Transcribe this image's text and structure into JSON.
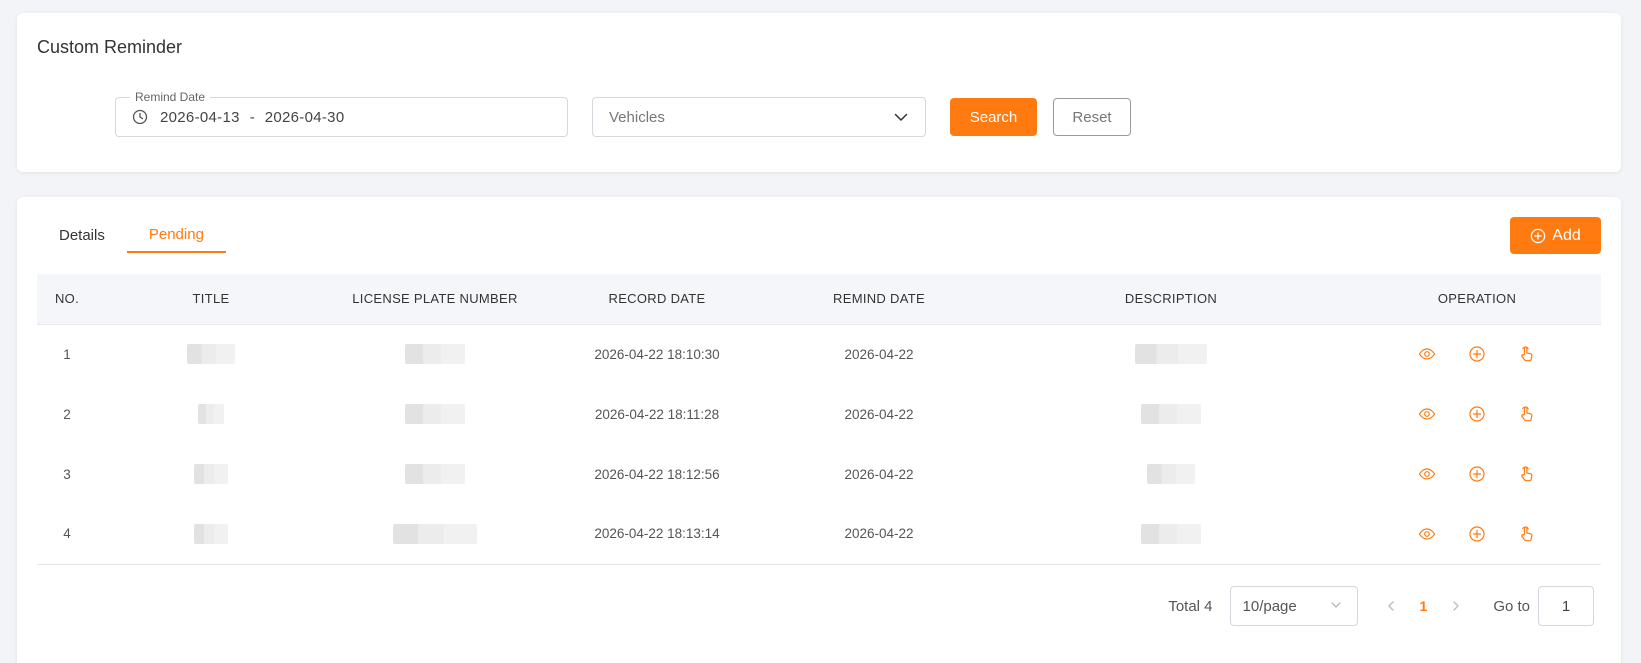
{
  "page": {
    "title": "Custom Reminder"
  },
  "filter": {
    "remind_date_label": "Remind Date",
    "date_start": "2026-04-13",
    "date_separator": "-",
    "date_end": "2026-04-30",
    "vehicles_placeholder": "Vehicles",
    "search_label": "Search",
    "reset_label": "Reset"
  },
  "tabs": [
    {
      "label": "Details",
      "active": false
    },
    {
      "label": "Pending",
      "active": true
    }
  ],
  "add_label": "Add",
  "table": {
    "columns": [
      "NO.",
      "TITLE",
      "LICENSE PLATE NUMBER",
      "RECORD DATE",
      "REMIND DATE",
      "DESCRIPTION",
      "OPERATION"
    ],
    "rows": [
      {
        "no": "1",
        "record_date": "2026-04-22 18:10:30",
        "remind_date": "2026-04-22"
      },
      {
        "no": "2",
        "record_date": "2026-04-22 18:11:28",
        "remind_date": "2026-04-22"
      },
      {
        "no": "3",
        "record_date": "2026-04-22 18:12:56",
        "remind_date": "2026-04-22"
      },
      {
        "no": "4",
        "record_date": "2026-04-22 18:13:14",
        "remind_date": "2026-04-22"
      }
    ],
    "operation_icons": [
      "eye-icon",
      "plus-circle-icon",
      "hand-pointer-icon"
    ]
  },
  "pagination": {
    "total_label": "Total 4",
    "page_size": "10/page",
    "current_page": "1",
    "goto_label": "Go to",
    "goto_value": "1"
  },
  "colors": {
    "accent": "#ff7a10",
    "header_bg": "#f5f6f9",
    "page_bg": "#f3f4f7"
  }
}
